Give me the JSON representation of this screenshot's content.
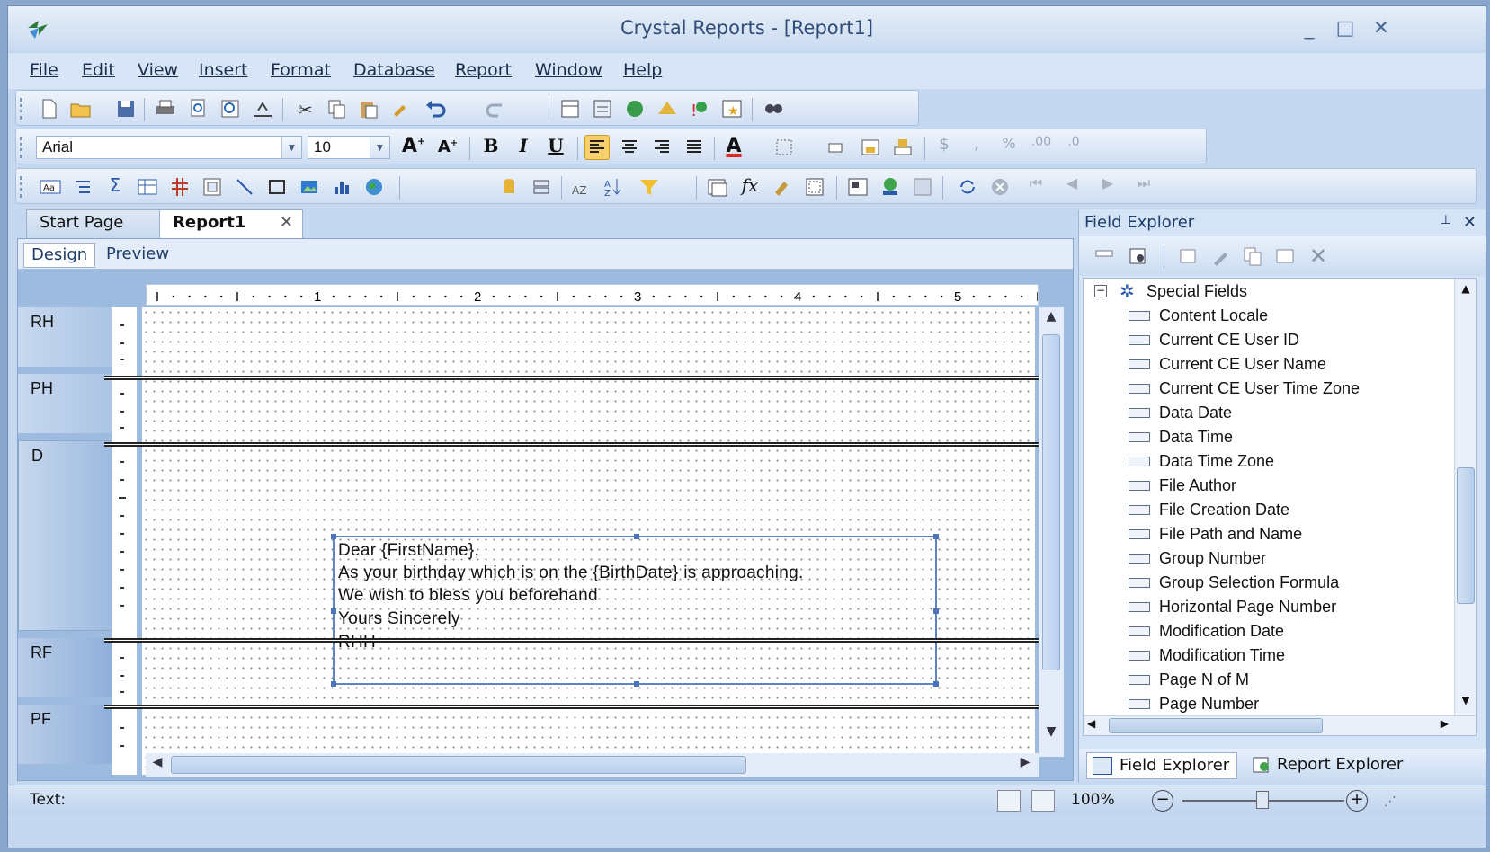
{
  "window": {
    "title": "Crystal Reports - [Report1]",
    "min": "_",
    "max": "□",
    "close": "✕"
  },
  "menu": [
    "File",
    "Edit",
    "View",
    "Insert",
    "Format",
    "Database",
    "Report",
    "Window",
    "Help"
  ],
  "format_toolbar": {
    "font": "Arial",
    "size": "10",
    "bold": "B",
    "italic": "I",
    "underline": "U",
    "font_color_glyph": "A",
    "currency": "$",
    "comma": ",",
    "percent": "%"
  },
  "doc_tabs": [
    {
      "label": "Start Page"
    },
    {
      "label": "Report1",
      "close": "✕"
    }
  ],
  "view_tabs": [
    "Design",
    "Preview"
  ],
  "ruler": {
    "marks": [
      "1",
      "2",
      "3",
      "4",
      "5"
    ]
  },
  "sections": [
    "RH",
    "PH",
    "D",
    "RF",
    "PF"
  ],
  "text_object": {
    "lines": [
      "Dear {FirstName},",
      "As your birthday which is on the {BirthDate} is approaching.",
      "We wish to bless you beforehand",
      "Yours Sincerely",
      "RHH"
    ]
  },
  "field_explorer": {
    "title": "Field Explorer",
    "pin": "📌",
    "close": "✕",
    "root": "Special Fields",
    "items": [
      "Content Locale",
      "Current CE User ID",
      "Current CE User Name",
      "Current CE User Time Zone",
      "Data Date",
      "Data Time",
      "Data Time Zone",
      "File Author",
      "File Creation Date",
      "File Path and Name",
      "Group Number",
      "Group Selection Formula",
      "Horizontal Page Number",
      "Modification Date",
      "Modification Time",
      "Page N of M",
      "Page Number"
    ],
    "bottom_tabs": [
      "Field Explorer",
      "Report Explorer"
    ]
  },
  "status": {
    "text": "Text:",
    "zoom": "100%",
    "zoom_out": "−",
    "zoom_in": "+"
  },
  "colors": {
    "accent": "#c6d8ef",
    "selection": "#5f84c5",
    "title": "#2f4d77"
  }
}
